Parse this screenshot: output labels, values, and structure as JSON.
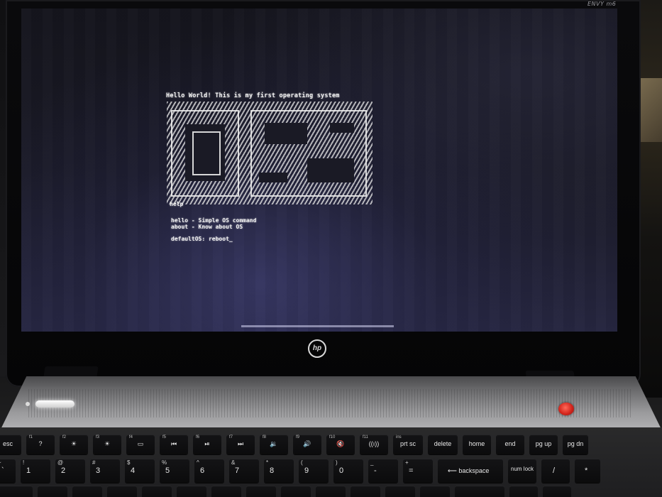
{
  "laptop": {
    "model_label": "ENVY m6",
    "logo_text": "hp"
  },
  "screen": {
    "lines": {
      "hello": "Hello World! This is my first operating system",
      "help": "help",
      "cmd_hello": "hello - Simple OS command",
      "cmd_about": "about - Know about OS",
      "prompt": "defaultOS: reboot_"
    },
    "logo_art": "OS"
  },
  "keyboard": {
    "row1": [
      {
        "name": "esc",
        "label": "esc",
        "top": ""
      },
      {
        "name": "f1",
        "label": "?",
        "top": "f1"
      },
      {
        "name": "f2",
        "label": "☀",
        "top": "f2"
      },
      {
        "name": "f3",
        "label": "☀",
        "top": "f3"
      },
      {
        "name": "f4",
        "label": "▭",
        "top": "f4"
      },
      {
        "name": "f5",
        "label": "⏮",
        "top": "f5"
      },
      {
        "name": "f6",
        "label": "⏯",
        "top": "f6"
      },
      {
        "name": "f7",
        "label": "⏭",
        "top": "f7"
      },
      {
        "name": "f8",
        "label": "🔉",
        "top": "f8"
      },
      {
        "name": "f9",
        "label": "🔊",
        "top": "f9"
      },
      {
        "name": "f10",
        "label": "🔇",
        "top": "f10"
      },
      {
        "name": "f11",
        "label": "((ı))",
        "top": "f11"
      },
      {
        "name": "prt-sc",
        "label": "prt sc",
        "top": "ins"
      },
      {
        "name": "delete",
        "label": "delete",
        "top": ""
      },
      {
        "name": "home",
        "label": "home",
        "top": ""
      },
      {
        "name": "end",
        "label": "end",
        "top": ""
      },
      {
        "name": "pg-up",
        "label": "pg up",
        "top": ""
      },
      {
        "name": "pg-dn",
        "label": "pg dn",
        "top": ""
      }
    ],
    "row2": [
      {
        "name": "backtick",
        "top": "~",
        "bot": "`"
      },
      {
        "name": "1",
        "top": "!",
        "bot": "1"
      },
      {
        "name": "2",
        "top": "@",
        "bot": "2"
      },
      {
        "name": "3",
        "top": "#",
        "bot": "3"
      },
      {
        "name": "4",
        "top": "$",
        "bot": "4"
      },
      {
        "name": "5",
        "top": "%",
        "bot": "5"
      },
      {
        "name": "6",
        "top": "^",
        "bot": "6"
      },
      {
        "name": "7",
        "top": "&",
        "bot": "7"
      },
      {
        "name": "8",
        "top": "*",
        "bot": "8"
      },
      {
        "name": "9",
        "top": "(",
        "bot": "9"
      },
      {
        "name": "0",
        "top": ")",
        "bot": "0"
      },
      {
        "name": "minus",
        "top": "_",
        "bot": "-"
      },
      {
        "name": "equals",
        "top": "+",
        "bot": "="
      },
      {
        "name": "backspace",
        "top": "",
        "bot": "⟵ backspace"
      },
      {
        "name": "num-lock",
        "top": "",
        "bot": "num lock"
      },
      {
        "name": "slash",
        "top": "",
        "bot": "/"
      },
      {
        "name": "asterisk",
        "top": "",
        "bot": "*"
      }
    ]
  },
  "colors": {
    "power_button": "#d4261d",
    "screen_bg": "#1a1a26",
    "bezel": "#0a0a0c"
  }
}
